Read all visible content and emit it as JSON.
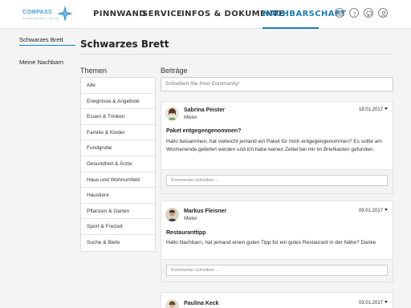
{
  "header": {
    "logo_text": "COMPASS",
    "logo_sub": "NACHBARSCHAFT · ONLINE",
    "nav": [
      "PINNWAND",
      "SERVICE",
      "INFOS & DOKUMENTE",
      "NACHBARSCHAFT"
    ],
    "active_nav": "NACHBARSCHAFT",
    "icons": [
      "mail-icon",
      "help-icon",
      "chat-icon",
      "user-icon"
    ],
    "accent_color": "#1b7fb6"
  },
  "sidebar": {
    "items": [
      "Schwarzes Brett",
      "Meine Nachbarn"
    ],
    "active": "Schwarzes Brett"
  },
  "main": {
    "title": "Schwarzes Brett",
    "topics_title": "Themen",
    "posts_title": "Beiträge",
    "topics": [
      "Alle",
      "Ereignisse & Angebote",
      "Essen & Trinken",
      "Familie & Kinder",
      "Fundgrube",
      "Gesundheit & Ärzte",
      "Haus und Wohnumfeld",
      "Haustiere",
      "Pflanzen & Garten",
      "Sport & Freizeit",
      "Suche & Biete"
    ],
    "search_placeholder": "Schreiben Sie Ihrer Community!",
    "comment_placeholder": "Kommentar schreiben ...",
    "posts": [
      {
        "author": "Sabrina Peister",
        "role": "Mieter",
        "date": "18.01.2017",
        "title": "Paket entgegengenommen?",
        "body": "Hallo beisammen, hat vielleicht jemand ein Paket für mich entgegengenommen? Es sollte am Wochenende geliefert werden und ich habe keinen Zettel bei mir im Briefkasten gefunden."
      },
      {
        "author": "Markus Fleisner",
        "role": "Mieter",
        "date": "09.01.2017",
        "title": "Restauranttipp",
        "body": "Hallo Nachbarn, hat jemand einen guten Tipp für ein gutes Restaurant in der Nähe? Danke"
      },
      {
        "author": "Paulina Keck",
        "role": "",
        "date": "03.01.2017",
        "title": "",
        "body": ""
      }
    ]
  }
}
